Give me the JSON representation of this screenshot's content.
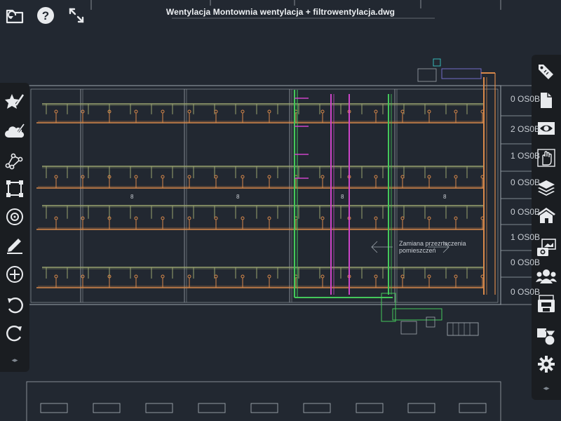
{
  "document": {
    "title": "Wentylacja Montownia wentylacja + filtrowentylacja.dwg"
  },
  "top_buttons": {
    "back_icon": "folder-back-icon",
    "help_icon": "help-icon",
    "fit_icon": "expand-icon"
  },
  "left_tools": [
    "smart-pen-icon",
    "cloud-markup-icon",
    "polyline-icon",
    "rectangle-icon",
    "circle-icon",
    "pencil-icon",
    "add-icon",
    "undo-icon",
    "redo-icon"
  ],
  "right_tools": [
    "tag-icon",
    "document-icon",
    "eye-icon",
    "hand-icon",
    "layers-icon",
    "building-icon",
    "camera-image-icon",
    "users-icon",
    "save-icon",
    "shapes-icon",
    "settings-icon"
  ],
  "drawing": {
    "room_labels": [
      "0 OS0B",
      "2 OS0B",
      "1 OS0B",
      "0 OS0B",
      "0 OS0B",
      "1 OS0B",
      "0 OS0B",
      "0 OS0B"
    ],
    "note": "Zamiana przeznaczenia pomieszczeń",
    "cell_marks": [
      "8",
      "8",
      "8",
      "8"
    ]
  },
  "colors": {
    "background": "#222831",
    "toolbar": "#1a1d21",
    "duct_orange": "#d9894a",
    "duct_green": "#44c85a",
    "duct_magenta": "#cc44c8",
    "duct_olive": "#9aa470",
    "lines": "#9fa7ae"
  }
}
